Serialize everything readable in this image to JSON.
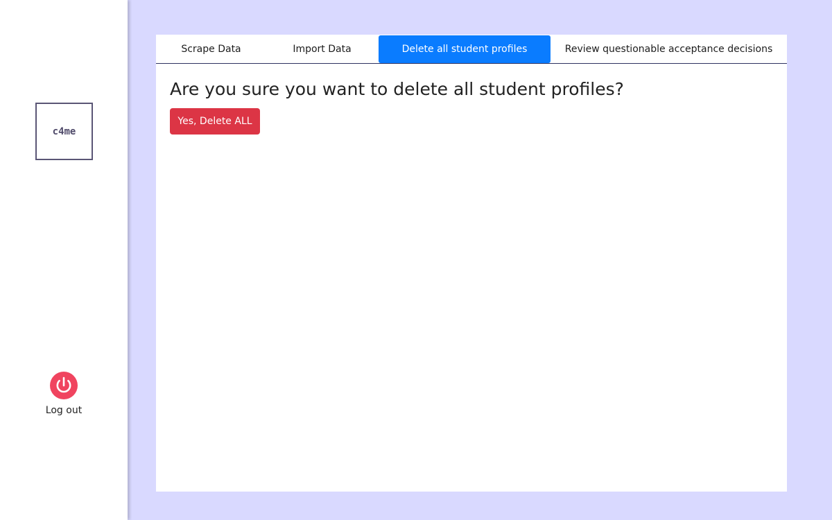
{
  "sidebar": {
    "logo_text": "c4me",
    "logout_label": "Log out",
    "logout_icon": "power-icon",
    "logout_icon_color": "#f0445f"
  },
  "tabs": [
    {
      "label": "Scrape Data",
      "active": false
    },
    {
      "label": "Import Data",
      "active": false
    },
    {
      "label": "Delete all student profiles",
      "active": true
    },
    {
      "label": "Review questionable acceptance decisions",
      "active": false
    }
  ],
  "main": {
    "heading": "Are you sure you want to delete all student profiles?",
    "confirm_button_label": "Yes, Delete ALL"
  },
  "colors": {
    "page_background": "#d9d9ff",
    "active_tab": "#0a7cff",
    "danger": "#dc3545"
  }
}
